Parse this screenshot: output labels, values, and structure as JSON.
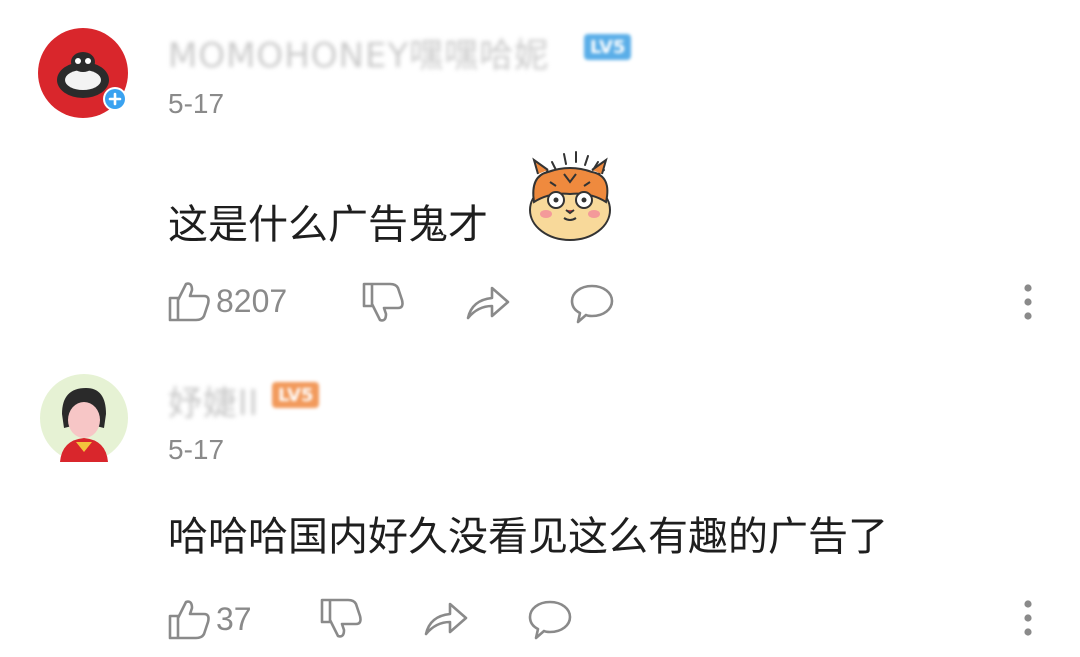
{
  "comments": [
    {
      "username": "MOMOHONEY嘿嘿哈妮",
      "level": "LV5",
      "date": "5-17",
      "text": "这是什么广告鬼才",
      "likes": "8207",
      "colors": {
        "avatar": "#d9262c",
        "badge": "#5aaee8",
        "username": "#cccccc"
      }
    },
    {
      "username": "妤婕ll",
      "level": "LV5",
      "date": "5-17",
      "text": "哈哈哈国内好久没看见这么有趣的广告了",
      "likes": "37",
      "colors": {
        "avatar": "#e8f4d6",
        "badge": "#f29a5c",
        "username": "#c8c8c8"
      }
    }
  ],
  "icons": {
    "like": "thumbs-up-icon",
    "dislike": "thumbs-down-icon",
    "share": "share-icon",
    "reply": "comment-icon",
    "more": "more-vertical-icon",
    "verified": "plus-badge-icon",
    "sticker": "tiger-sticker-icon"
  }
}
